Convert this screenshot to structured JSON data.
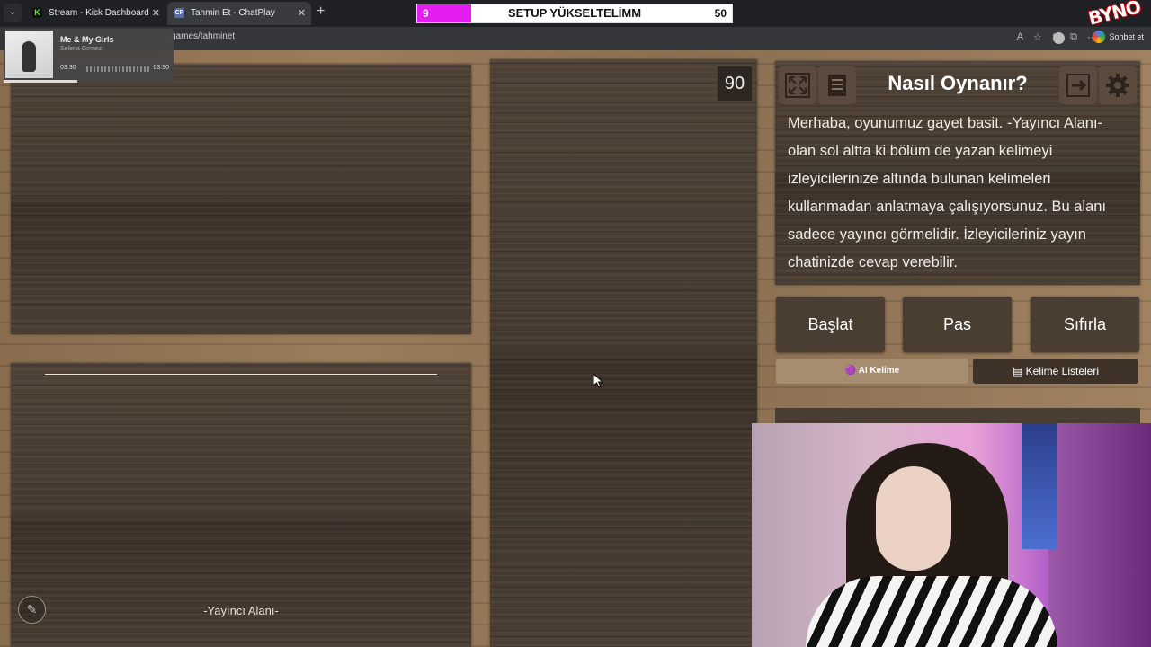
{
  "browser": {
    "tabs": [
      {
        "label": "Stream - Kick Dashboard",
        "icon": "kick-icon"
      },
      {
        "label": "Tahmin Et - ChatPlay",
        "icon": "chatplay-icon"
      }
    ],
    "url": "games/tahminet",
    "chat_button": "Sohbet et"
  },
  "overlay": {
    "goal_current": "9",
    "goal_title": "SETUP YÜKSELTELİMM",
    "goal_target": "50",
    "brand": "BYNO..."
  },
  "media": {
    "song": "Me & My Girls",
    "artist": "Selena Gomez",
    "time_elapsed": "03:30",
    "time_total": "03:30"
  },
  "game": {
    "timer": "90",
    "streamer_area_label": "-Yayıncı Alanı-",
    "info_title": "Nasıl Oynanır?",
    "info_text": "Merhaba, oyunumuz gayet basit. -Yayıncı Alanı- olan sol altta ki bölüm de yazan kelimeyi izleyicilerinize altında bulunan kelimeleri kullanmadan anlatmaya çalışıyorsunuz. Bu alanı sadece yayıncı görmelidir. İzleyicileriniz yayın chatinizde cevap verebilir.",
    "buttons": {
      "start": "Başlat",
      "pass": "Pas",
      "reset": "Sıfırla",
      "ai_word": "🟣 AI Kelime",
      "word_lists": "Kelime Listeleri"
    }
  }
}
